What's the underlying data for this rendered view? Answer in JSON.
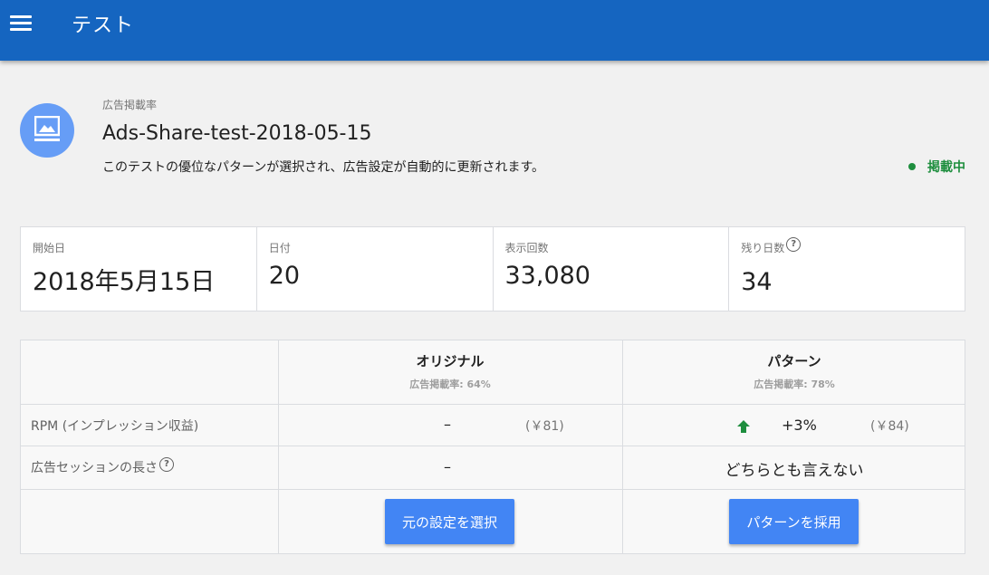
{
  "appbar": {
    "title": "テスト"
  },
  "test": {
    "overline": "広告掲載率",
    "name": "Ads-Share-test-2018-05-15",
    "description": "このテストの優位なパターンが選択され、広告設定が自動的に更新されます。",
    "status": "掲載中",
    "status_color": "#1e8e3e"
  },
  "stats": [
    {
      "label": "開始日",
      "value": "2018年5月15日"
    },
    {
      "label": "日付",
      "value": "20"
    },
    {
      "label": "表示回数",
      "value": "33,080"
    },
    {
      "label": "残り日数",
      "value": "34"
    }
  ],
  "comparison": {
    "original": {
      "title": "オリジナル",
      "subtitle": "広告掲載率: 64%"
    },
    "pattern": {
      "title": "パターン",
      "subtitle": "広告掲載率: 78%"
    },
    "rows": {
      "rpm": {
        "label": "RPM (インプレッション収益)",
        "original_value": "–",
        "original_sub": "(￥81)",
        "pattern_value": "+3%",
        "pattern_sub": "(￥84)"
      },
      "session": {
        "label": "広告セッションの長さ",
        "original_value": "–",
        "pattern_value": "どちらとも言えない"
      }
    },
    "buttons": {
      "select_original": "元の設定を選択",
      "adopt_pattern": "パターンを採用"
    }
  },
  "colors": {
    "appbar": "#1565c0",
    "primary_button": "#4285f4",
    "avatar": "#669df6",
    "positive": "#1e8e3e"
  }
}
